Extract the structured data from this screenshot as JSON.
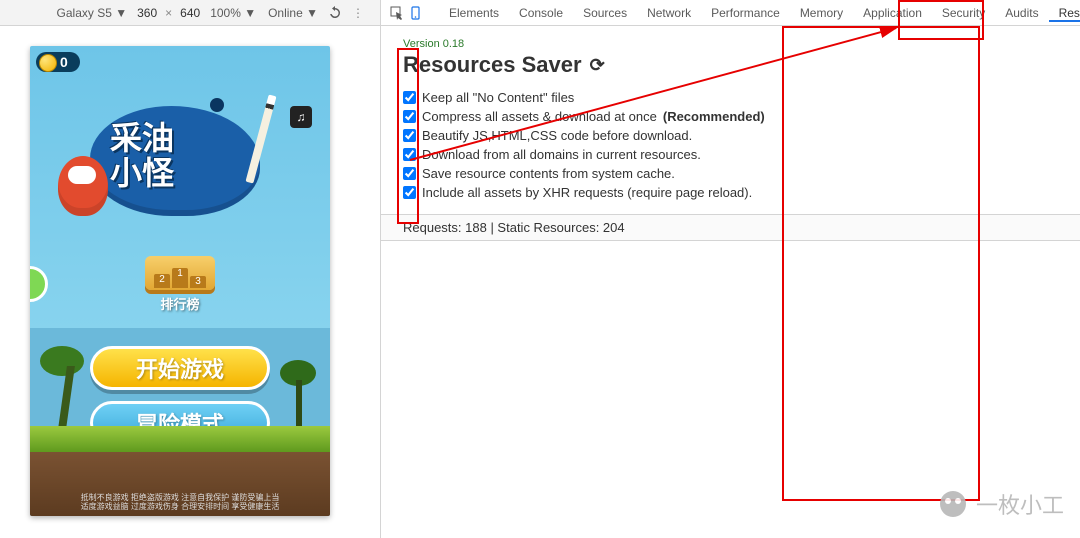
{
  "device_toolbar": {
    "device": "Galaxy S5 ▼",
    "width": "360",
    "mult": "×",
    "height": "640",
    "zoom": "100% ▼",
    "network": "Online ▼"
  },
  "game": {
    "coins": "0",
    "logo_line1": "采油",
    "logo_line2": "小怪",
    "music_icon": "♫",
    "ranking_label": "排行榜",
    "podium": [
      "2",
      "1",
      "3"
    ],
    "btn_start": "开始游戏",
    "btn_adventure": "冒险模式",
    "disclaimer_line1": "抵制不良游戏 拒绝盗版游戏 注意自我保护 谨防受骗上当",
    "disclaimer_line2": "适度游戏益脑 过度游戏伤身 合理安排时间 享受健康生活"
  },
  "devtools": {
    "tabs": [
      "Elements",
      "Console",
      "Sources",
      "Network",
      "Performance",
      "Memory",
      "Application",
      "Security",
      "Audits",
      "ResourcesSaver"
    ],
    "active_tab": "ResourcesSaver"
  },
  "resources_saver": {
    "version_label": "Version 0.18",
    "title": "Resources Saver",
    "reload_glyph": "⟳",
    "options": [
      {
        "label_pre": "Keep all \"No Content\" files",
        "label_strong": ""
      },
      {
        "label_pre": "Compress all assets & download at once ",
        "label_strong": "(Recommended)"
      },
      {
        "label_pre": "Beautify JS,HTML,CSS code before download.",
        "label_strong": ""
      },
      {
        "label_pre": "Download from all domains in current resources.",
        "label_strong": ""
      },
      {
        "label_pre": "Save resource contents from system cache.",
        "label_strong": ""
      },
      {
        "label_pre": "Include all assets by XHR requests (require page reload).",
        "label_strong": ""
      }
    ],
    "stats": "Requests: 188 | Static Resources: 204"
  },
  "watermark": {
    "text": "一枚小工"
  }
}
